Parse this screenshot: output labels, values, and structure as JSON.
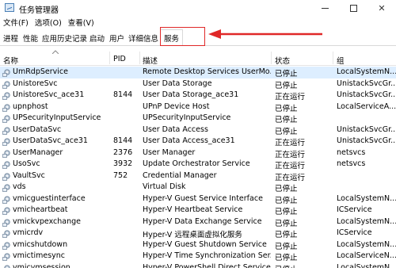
{
  "window": {
    "title": "任务管理器"
  },
  "menu": [
    "文件(F)",
    "选项(O)",
    "查看(V)"
  ],
  "tabs": [
    "进程",
    "性能",
    "应用历史记录",
    "启动",
    "用户",
    "详细信息",
    "服务"
  ],
  "active_tab": "服务",
  "columns": {
    "name": "名称",
    "pid": "PID",
    "description": "描述",
    "status": "状态",
    "group": "组"
  },
  "colors": {
    "highlight_box": "#e02828",
    "selected_row": "#ddeeff",
    "icon": "service-gear-icon"
  },
  "rows": [
    {
      "name": "UmRdpService",
      "pid": "",
      "description": "Remote Desktop Services UserMo...",
      "status": "已停止",
      "group": "LocalSystemN..."
    },
    {
      "name": "UnistoreSvc",
      "pid": "",
      "description": "User Data Storage",
      "status": "已停止",
      "group": "UnistackSvcGr..."
    },
    {
      "name": "UnistoreSvc_ace31",
      "pid": "8144",
      "description": "User Data Storage_ace31",
      "status": "正在运行",
      "group": "UnistackSvcGr..."
    },
    {
      "name": "upnphost",
      "pid": "",
      "description": "UPnP Device Host",
      "status": "已停止",
      "group": "LocalServiceA..."
    },
    {
      "name": "UPSecurityInputService",
      "pid": "",
      "description": "UPSecurityInputService",
      "status": "已停止",
      "group": ""
    },
    {
      "name": "UserDataSvc",
      "pid": "",
      "description": "User Data Access",
      "status": "已停止",
      "group": "UnistackSvcGr..."
    },
    {
      "name": "UserDataSvc_ace31",
      "pid": "8144",
      "description": "User Data Access_ace31",
      "status": "正在运行",
      "group": "UnistackSvcGr..."
    },
    {
      "name": "UserManager",
      "pid": "2376",
      "description": "User Manager",
      "status": "正在运行",
      "group": "netsvcs"
    },
    {
      "name": "UsoSvc",
      "pid": "3932",
      "description": "Update Orchestrator Service",
      "status": "正在运行",
      "group": "netsvcs"
    },
    {
      "name": "VaultSvc",
      "pid": "752",
      "description": "Credential Manager",
      "status": "正在运行",
      "group": ""
    },
    {
      "name": "vds",
      "pid": "",
      "description": "Virtual Disk",
      "status": "已停止",
      "group": ""
    },
    {
      "name": "vmicguestinterface",
      "pid": "",
      "description": "Hyper-V Guest Service Interface",
      "status": "已停止",
      "group": "LocalSystemN..."
    },
    {
      "name": "vmicheartbeat",
      "pid": "",
      "description": "Hyper-V Heartbeat Service",
      "status": "已停止",
      "group": "ICService"
    },
    {
      "name": "vmickvpexchange",
      "pid": "",
      "description": "Hyper-V Data Exchange Service",
      "status": "已停止",
      "group": "LocalSystemN..."
    },
    {
      "name": "vmicrdv",
      "pid": "",
      "description": "Hyper-V 远程桌面虚拟化服务",
      "status": "已停止",
      "group": "ICService"
    },
    {
      "name": "vmicshutdown",
      "pid": "",
      "description": "Hyper-V Guest Shutdown Service",
      "status": "已停止",
      "group": "LocalSystemN..."
    },
    {
      "name": "vmictimesync",
      "pid": "",
      "description": "Hyper-V Time Synchronization Ser...",
      "status": "已停止",
      "group": "LocalServiceN..."
    },
    {
      "name": "vmicvmsession",
      "pid": "",
      "description": "Hyper-V PowerShell Direct Service",
      "status": "已停止",
      "group": "LocalSystemN..."
    }
  ]
}
